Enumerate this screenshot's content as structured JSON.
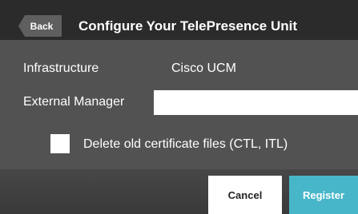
{
  "header": {
    "back_label": "Back",
    "title": "Configure Your TelePresence Unit"
  },
  "form": {
    "infrastructure_label": "Infrastructure",
    "infrastructure_value": "Cisco UCM",
    "external_manager_label": "External Manager",
    "external_manager_value": "",
    "delete_certs_label": "Delete old certificate files (CTL, ITL)",
    "delete_certs_checked": false
  },
  "footer": {
    "cancel_label": "Cancel",
    "register_label": "Register"
  },
  "colors": {
    "header_bg": "#2b2b2b",
    "panel_bg": "#525252",
    "accent": "#47b6c8"
  }
}
